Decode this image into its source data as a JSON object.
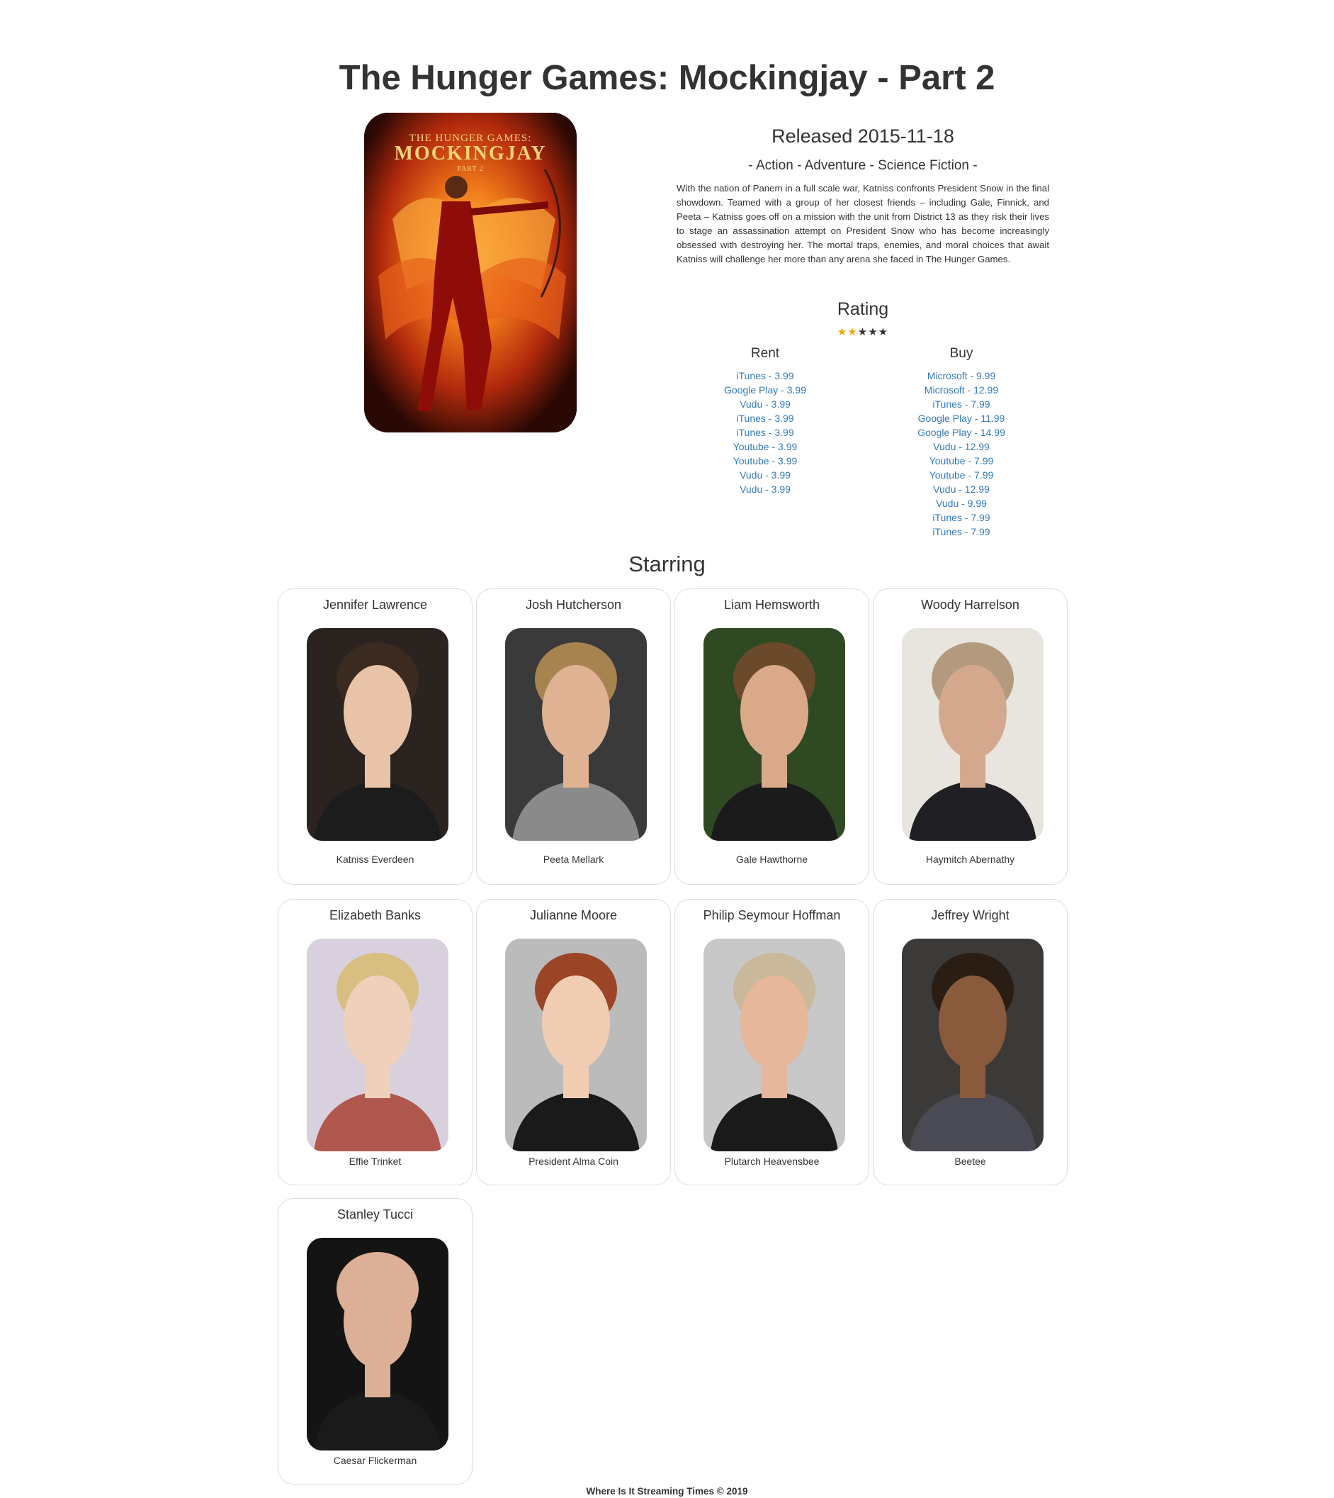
{
  "title": "The Hunger Games: Mockingjay - Part 2",
  "poster": {
    "alt": "The Hunger Games: Mockingjay Part 2 poster",
    "line1": "THE HUNGER GAMES:",
    "line2": "MOCKINGJAY",
    "line3": "PART 2"
  },
  "released": "Released 2015-11-18",
  "genres": "- Action - Adventure - Science Fiction -",
  "overview": "With the nation of Panem in a full scale war, Katniss confronts President Snow in the final showdown. Teamed with a group of her closest friends – including Gale, Finnick, and Peeta – Katniss goes off on a mission with the unit from District 13 as they risk their lives to stage an assassination attempt on President Snow who has become increasingly obsessed with destroying her. The mortal traps, enemies, and moral choices that await Katniss will challenge her more than any arena she faced in The Hunger Games.",
  "rating": {
    "heading": "Rating",
    "stars_filled": 2,
    "stars_total": 5,
    "filled_color": "#f0a500",
    "empty_color": "#333333"
  },
  "providers": {
    "rent_heading": "Rent",
    "buy_heading": "Buy",
    "link_color": "#337ab7",
    "rent": [
      "iTunes - 3.99",
      "Google Play - 3.99",
      "Vudu - 3.99",
      "iTunes - 3.99",
      "iTunes - 3.99",
      "Youtube - 3.99",
      "Youtube - 3.99",
      "Vudu - 3.99",
      "Vudu - 3.99"
    ],
    "buy": [
      "Microsoft - 9.99",
      "Microsoft - 12.99",
      "iTunes - 7.99",
      "Google Play - 11.99",
      "Google Play - 14.99",
      "Vudu - 12.99",
      "Youtube - 7.99",
      "Youtube - 7.99",
      "Vudu - 12.99",
      "Vudu - 9.99",
      "iTunes - 7.99",
      "iTunes - 7.99"
    ]
  },
  "starring_heading": "Starring",
  "cast": [
    {
      "actor": "Jennifer Lawrence",
      "character": "Katniss Everdeen",
      "bg": "#2a2320",
      "skin": "#e9c3a8",
      "hair": "#3a2a20",
      "shirt": "#1c1c1c"
    },
    {
      "actor": "Josh Hutcherson",
      "character": "Peeta Mellark",
      "bg": "#3a3a3a",
      "skin": "#dfb294",
      "hair": "#a6834f",
      "shirt": "#8a8a8a"
    },
    {
      "actor": "Liam Hemsworth",
      "character": "Gale Hawthorne",
      "bg": "#2f4a22",
      "skin": "#d9a98a",
      "hair": "#6b4a2c",
      "shirt": "#1b1b1b"
    },
    {
      "actor": "Woody Harrelson",
      "character": "Haymitch Abernathy",
      "bg": "#e8e4de",
      "skin": "#d4a88c",
      "hair": "#b39a7e",
      "shirt": "#1f1f24"
    },
    {
      "actor": "Elizabeth Banks",
      "character": "Effie Trinket",
      "bg": "#d9d0dd",
      "skin": "#efd0bb",
      "hair": "#d8be80",
      "shirt": "#b0584e"
    },
    {
      "actor": "Julianne Moore",
      "character": "President Alma Coin",
      "bg": "#bbbbbb",
      "skin": "#f1cdb4",
      "hair": "#9b4426",
      "shirt": "#1a1a1a"
    },
    {
      "actor": "Philip Seymour Hoffman",
      "character": "Plutarch Heavensbee",
      "bg": "#c8c8c8",
      "skin": "#e6b79a",
      "hair": "#c9b89a",
      "shirt": "#1a1a1a"
    },
    {
      "actor": "Jeffrey Wright",
      "character": "Beetee",
      "bg": "#3c3a38",
      "skin": "#8a5a3c",
      "hair": "#2a1d14",
      "shirt": "#4a4a55"
    },
    {
      "actor": "Stanley Tucci",
      "character": "Caesar Flickerman",
      "bg": "#141414",
      "skin": "#dcb096",
      "hair": "#dcb096",
      "shirt": "#1a1a1a"
    }
  ],
  "footer": "Where Is It Streaming Times © 2019"
}
